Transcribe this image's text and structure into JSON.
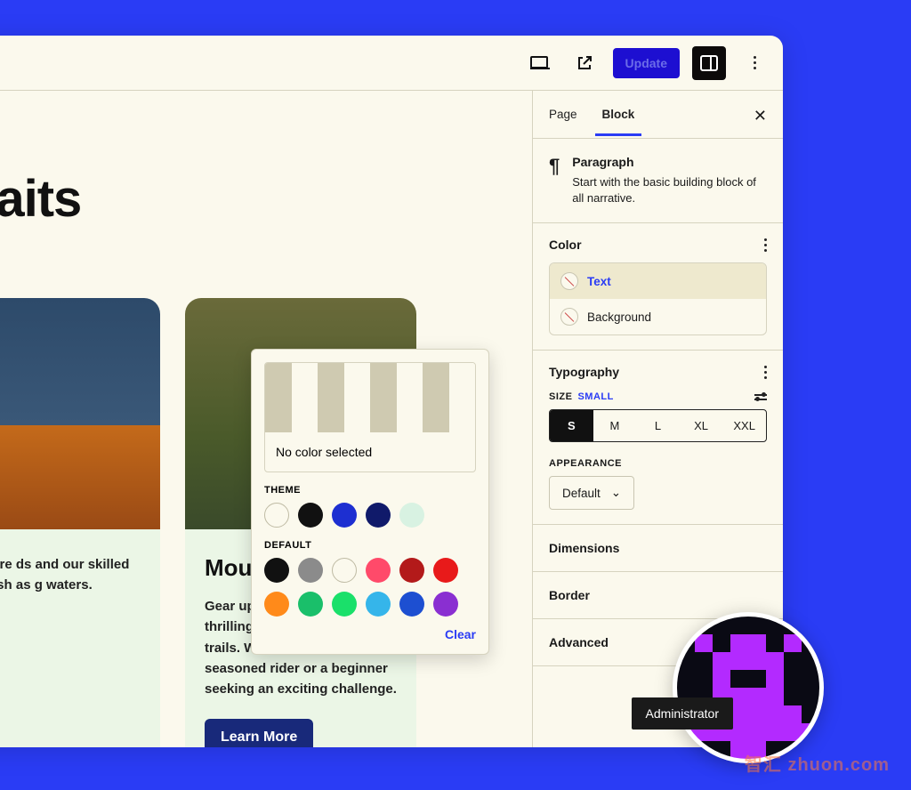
{
  "toolbar": {
    "update_label": "Update"
  },
  "canvas": {
    "headline": "awaits",
    "card1": {
      "title_fragment": "",
      "desc": "adventure ds and our skilled mate rush as g waters."
    },
    "card2": {
      "title": "Moun",
      "desc": "Gear up fo escapade on our thrilling mountain biking trails. Whether you're a seasoned rider or a beginner seeking an exciting challenge.",
      "button": "Learn More"
    }
  },
  "sidebar": {
    "tabs": {
      "page": "Page",
      "block": "Block"
    },
    "block": {
      "name": "Paragraph",
      "desc": "Start with the basic building block of all narrative."
    },
    "color": {
      "title": "Color",
      "text_label": "Text",
      "background_label": "Background"
    },
    "typography": {
      "title": "Typography",
      "size_label": "SIZE",
      "size_current": "SMALL",
      "options": [
        "S",
        "M",
        "L",
        "XL",
        "XXL"
      ],
      "appearance_label": "APPEARANCE",
      "appearance_value": "Default"
    },
    "panels": {
      "dimensions": "Dimensions",
      "border": "Border",
      "advanced": "Advanced"
    }
  },
  "popover": {
    "no_color": "No color selected",
    "theme_label": "THEME",
    "default_label": "DEFAULT",
    "clear": "Clear",
    "theme_colors": [
      "#fbf9ed",
      "#111111",
      "#1d2fd1",
      "#101a6a",
      "#d8f2e2"
    ],
    "default_colors_row1": [
      "#111111",
      "#8b8b8b",
      "#fbf9ed",
      "#ff4a6a",
      "#b31a1a",
      "#e81a1a"
    ],
    "default_colors_row2": [
      "#ff8a1a",
      "#1abf6a",
      "#1ae06a",
      "#35b5ea",
      "#1d4fd1",
      "#8a2fd1"
    ]
  },
  "tooltip": {
    "label": "Administrator"
  },
  "watermark": "智汇 zhuon.com"
}
